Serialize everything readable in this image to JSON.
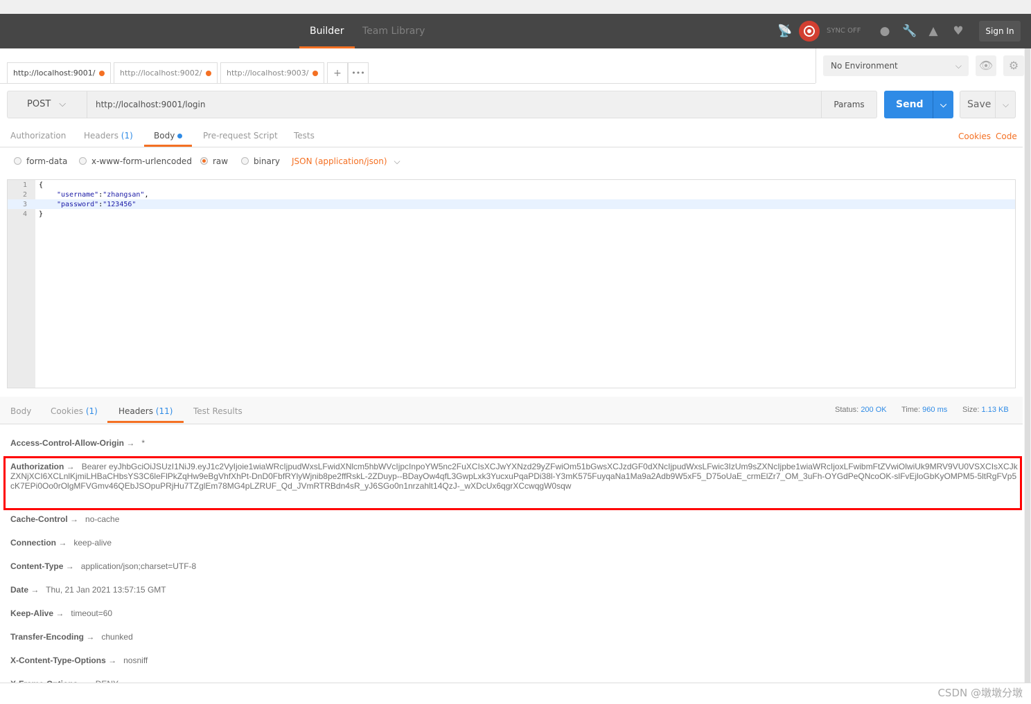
{
  "header": {
    "tabs": [
      "Builder",
      "Team Library"
    ],
    "sync": "SYNC OFF",
    "sign_in": "Sign In"
  },
  "tabs": [
    {
      "url": "http://localhost:9001/"
    },
    {
      "url": "http://localhost:9002/"
    },
    {
      "url": "http://localhost:9003/"
    }
  ],
  "tab_actions": {
    "add": "+",
    "more": "•••"
  },
  "environment": "No Environment",
  "request": {
    "method": "POST",
    "url": "http://localhost:9001/login",
    "params": "Params",
    "send": "Send",
    "save": "Save"
  },
  "request_tabs": {
    "authorization": "Authorization",
    "headers": "Headers",
    "headers_count": "(1)",
    "body": "Body",
    "prerequest": "Pre-request Script",
    "tests": "Tests",
    "cookies": "Cookies",
    "code": "Code"
  },
  "body_modes": {
    "form_data": "form-data",
    "urlencoded": "x-www-form-urlencoded",
    "raw": "raw",
    "binary": "binary",
    "content_type": "JSON (application/json)"
  },
  "editor": {
    "lines": [
      "1",
      "2",
      "3",
      "4"
    ],
    "l1": "{",
    "key1": "\"username\"",
    "val1": "\"zhangsan\"",
    "key2": "\"password\"",
    "val2": "\"123456\"",
    "l4": "}"
  },
  "response": {
    "tabs": {
      "body": "Body",
      "cookies": "Cookies",
      "cookies_count": "(1)",
      "headers": "Headers",
      "headers_count": "(11)",
      "tests": "Test Results"
    },
    "status_label": "Status:",
    "status": "200 OK",
    "time_label": "Time:",
    "time": "960 ms",
    "size_label": "Size:",
    "size": "1.13 KB",
    "headers": [
      {
        "key": "Access-Control-Allow-Origin",
        "value": "*"
      },
      {
        "key": "Authorization",
        "value": "Bearer eyJhbGciOiJSUzI1NiJ9.eyJ1c2VyIjoie1wiaWRcIjpudWxsLFwidXNlcm5hbWVcIjpcInpoYW5nc2FuXCIsXCJwYXNzd29yZFwiOm51bGwsXCJzdGF0dXNcIjpudWxsLFwic3IzUm9sZXNcIjpbe1wiaWRcIjoxLFwibmFtZVwiOlwiUk9MRV9VU0VSXCIsXCJkZXNjXCI6XCLnlKjmiLHBaCHbsYS3C6leFlPkZqHw9eBgVhfXhPt-DnD0FbfRYlyWjnib8pe2ffRskL-2ZDuyp--BDayOw4qfL3GwpLxk3YucxuPqaPDi38l-Y3mK575FuyqaNa1Ma9a2Adb9W5xF5_D75oUaE_crmElZr7_OM_3uFh-OYGdPeQNcoOK-slFvEjloGbKyOMPM5-5ltRgFVp5cK7EPi0Oo0rOlgMFVGmv46QEbJSOpuPRjHu7TZglEm78MG4pLZRUF_Qd_JVmRTRBdn4sR_yJ6SGo0n1nrzahlt14QzJ-_wXDcUx6qgrXCcwqgW0sqw"
      },
      {
        "key": "Cache-Control",
        "value": "no-cache"
      },
      {
        "key": "Connection",
        "value": "keep-alive"
      },
      {
        "key": "Content-Type",
        "value": "application/json;charset=UTF-8"
      },
      {
        "key": "Date",
        "value": "Thu, 21 Jan 2021 13:57:15 GMT"
      },
      {
        "key": "Keep-Alive",
        "value": "timeout=60"
      },
      {
        "key": "Transfer-Encoding",
        "value": "chunked"
      },
      {
        "key": "X-Content-Type-Options",
        "value": "nosniff"
      },
      {
        "key": "X-Frame-Options",
        "value": "DENY"
      }
    ]
  },
  "arrow": "→",
  "watermark": "CSDN @墩墩分墩",
  "colors": {
    "accent": "#f47023",
    "send": "#2f8be6",
    "header_bg": "#464646",
    "highlight": "#ff0000"
  }
}
